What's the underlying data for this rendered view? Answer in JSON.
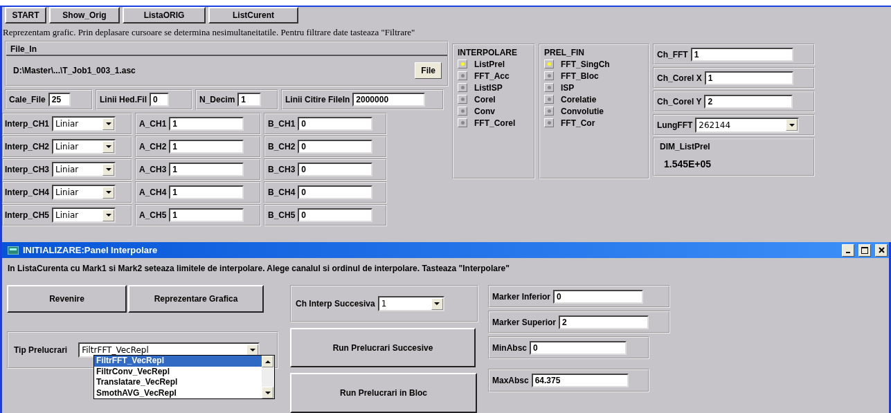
{
  "toolbar_buttons": [
    "START",
    "Show_Orig",
    "ListaORIG",
    "ListCurent"
  ],
  "instruction": "Reprezentam grafic. Prin deplasare cursoare se determina nesimultaneitatile. Pentru filtrare date tasteaza \"Filtrare\"",
  "file_in": {
    "title": "File_In",
    "path": "D:\\Master\\...\\T_Job1_003_1.asc",
    "button": "File"
  },
  "params": [
    {
      "label": "Cale_File",
      "value": "25"
    },
    {
      "label": "Linii Hed.Fil",
      "value": "0"
    },
    {
      "label": "N_Decim",
      "value": "1"
    },
    {
      "label": "Linii Citire FileIn",
      "value": "2000000"
    }
  ],
  "channels": [
    {
      "interp_label": "Interp_CH1",
      "interp_value": "Liniar",
      "a_label": "A_CH1",
      "a_value": "1",
      "b_label": "B_CH1",
      "b_value": "0"
    },
    {
      "interp_label": "Interp_CH2",
      "interp_value": "Liniar",
      "a_label": "A_CH2",
      "a_value": "1",
      "b_label": "B_CH2",
      "b_value": "0"
    },
    {
      "interp_label": "Interp_CH3",
      "interp_value": "Liniar",
      "a_label": "A_CH3",
      "a_value": "1",
      "b_label": "B_CH3",
      "b_value": "0"
    },
    {
      "interp_label": "Interp_CH4",
      "interp_value": "Liniar",
      "a_label": "A_CH4",
      "a_value": "1",
      "b_label": "B_CH4",
      "b_value": "0"
    },
    {
      "interp_label": "Interp_CH5",
      "interp_value": "Liniar",
      "a_label": "A_CH5",
      "a_value": "1",
      "b_label": "B_CH5",
      "b_value": "0"
    }
  ],
  "interpolare": {
    "title": "INTERPOLARE",
    "options": [
      {
        "label": "ListPrel",
        "selected": true
      },
      {
        "label": "FFT_Acc",
        "selected": false
      },
      {
        "label": "ListISP",
        "selected": false
      },
      {
        "label": "Corel",
        "selected": false
      },
      {
        "label": "Conv",
        "selected": false
      },
      {
        "label": "FFT_Corel",
        "selected": false
      }
    ]
  },
  "prel_fin": {
    "title": "PREL_FIN",
    "options": [
      {
        "label": "FFT_SingCh",
        "selected": true
      },
      {
        "label": "FFT_Bloc",
        "selected": false
      },
      {
        "label": "ISP",
        "selected": false
      },
      {
        "label": "Corelatie",
        "selected": false
      },
      {
        "label": "Convolutie",
        "selected": false
      },
      {
        "label": "FFT_Cor",
        "selected": false
      }
    ]
  },
  "right_fields": [
    {
      "kind": "input",
      "label": "Ch_FFT",
      "value": "1"
    },
    {
      "kind": "input",
      "label": "Ch_Corel X",
      "value": "1"
    },
    {
      "kind": "input",
      "label": "Ch_Corel Y",
      "value": "2"
    },
    {
      "kind": "select",
      "label": "LungFFT",
      "value": "262144"
    }
  ],
  "dim": {
    "title": "DIM_ListPrel",
    "value": "1.545E+05"
  },
  "panel": {
    "title": "INITIALIZARE:Panel Interpolare",
    "instruction": "In ListaCurenta cu Mark1 si Mark2 seteaza limitele de interpolare. Alege canalul si ordinul de interpolare. Tasteaza \"Interpolare\"",
    "buttons": [
      "Revenire",
      "Reprezentare Grafica"
    ],
    "tip": {
      "label": "Tip  Prelucrari",
      "value": "FiltrFFT_VecRepl",
      "options": [
        {
          "label": "FiltrFFT_VecRepl",
          "selected": true
        },
        {
          "label": "FiltrConv_VecRepl",
          "selected": false
        },
        {
          "label": "Translatare_VecRepl",
          "selected": false
        },
        {
          "label": "SmothAVG_VecRepl",
          "selected": false
        }
      ]
    },
    "ch_interp": {
      "label": "Ch Interp Succesiva",
      "value": "1"
    },
    "run_buttons": [
      "Run Prelucrari Succesive",
      "Run Prelucrari in Bloc"
    ],
    "markers": [
      {
        "label": "Marker Inferior",
        "value": "0"
      },
      {
        "label": "Marker Superior",
        "value": "2"
      },
      {
        "label": "MinAbsc",
        "value": "0"
      },
      {
        "label": "MaxAbsc",
        "value": "64.375"
      }
    ]
  }
}
